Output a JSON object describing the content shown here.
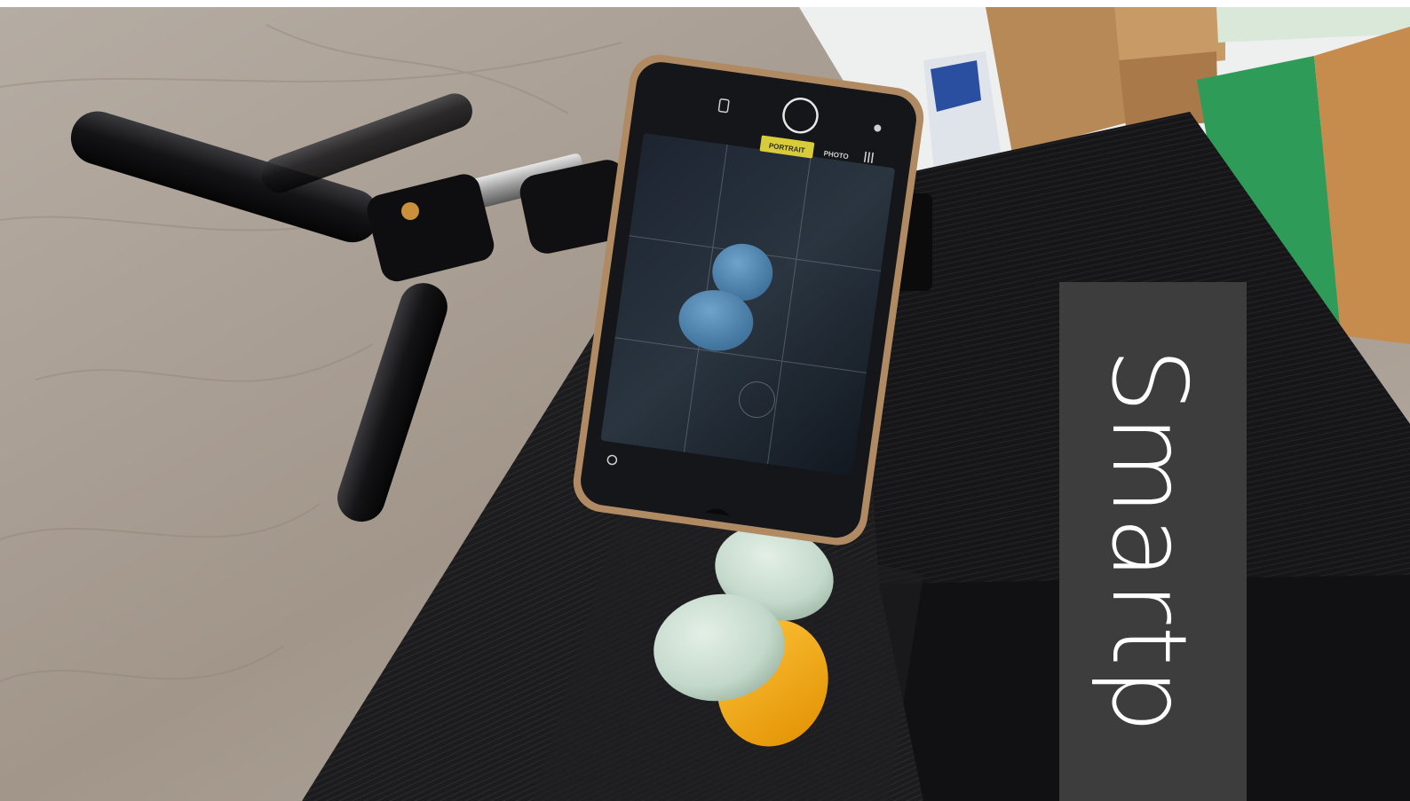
{
  "scene": {
    "colors": {
      "table_surface": "#a79c92",
      "black_box": "#1d1d1f",
      "phone_body": "#15161a",
      "phone_frame": "#b08a63",
      "egg": "#c9ddd0",
      "yellow_cap": "#f4a81a",
      "camera_preview_egg": "#4f86b4",
      "cardboard": "#b88a5a",
      "green_box": "#2f9b58",
      "banner": "#3d3d3d"
    },
    "phone_screen": {
      "mode_selected": "PORTRAIT",
      "mode_other": "PHOTO"
    }
  },
  "banner": {
    "text": "Smartp"
  }
}
